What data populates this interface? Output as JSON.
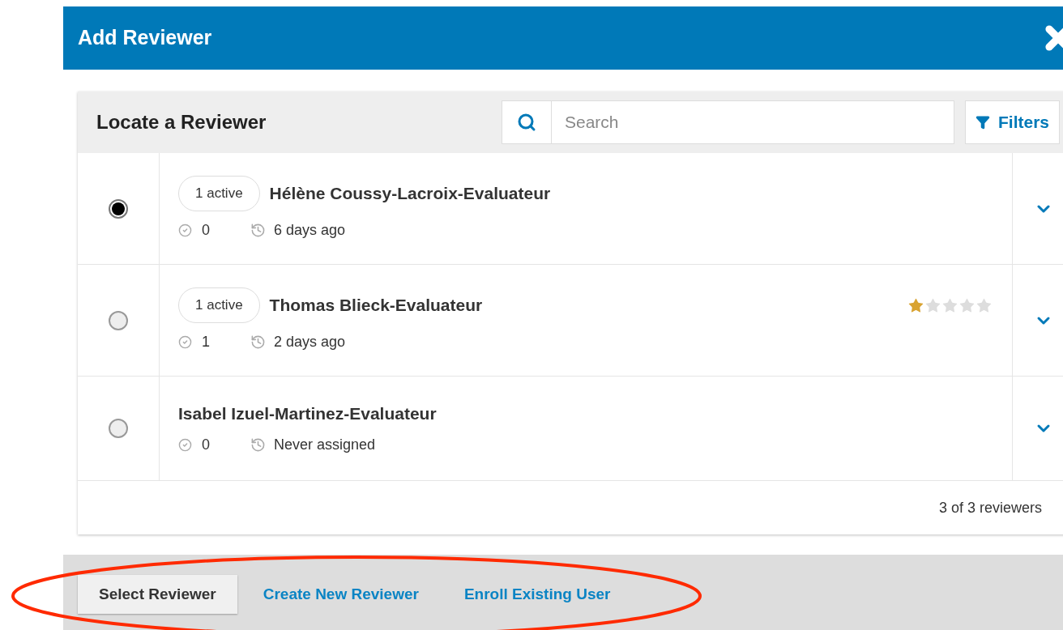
{
  "dialog": {
    "title": "Add Reviewer"
  },
  "panel": {
    "title": "Locate a Reviewer",
    "search": {
      "placeholder": "Search"
    },
    "filters_label": "Filters"
  },
  "reviewers": [
    {
      "name": "Hélène Coussy-Lacroix-Evaluateur",
      "active_badge": "1 active",
      "completed": "0",
      "last_assigned": "6 days ago",
      "selected": true
    },
    {
      "name": "Thomas Blieck-Evaluateur",
      "active_badge": "1 active",
      "completed": "1",
      "last_assigned": "2 days ago",
      "selected": false,
      "stars": 1
    },
    {
      "name": "Isabel Izuel-Martinez-Evaluateur",
      "completed": "0",
      "last_assigned": "Never assigned",
      "selected": false
    }
  ],
  "count": "3 of 3 reviewers",
  "actions": {
    "primary": "Select Reviewer",
    "links": [
      "Create New Reviewer",
      "Enroll Existing User"
    ]
  },
  "annotation": {
    "kind": "ellipse"
  }
}
